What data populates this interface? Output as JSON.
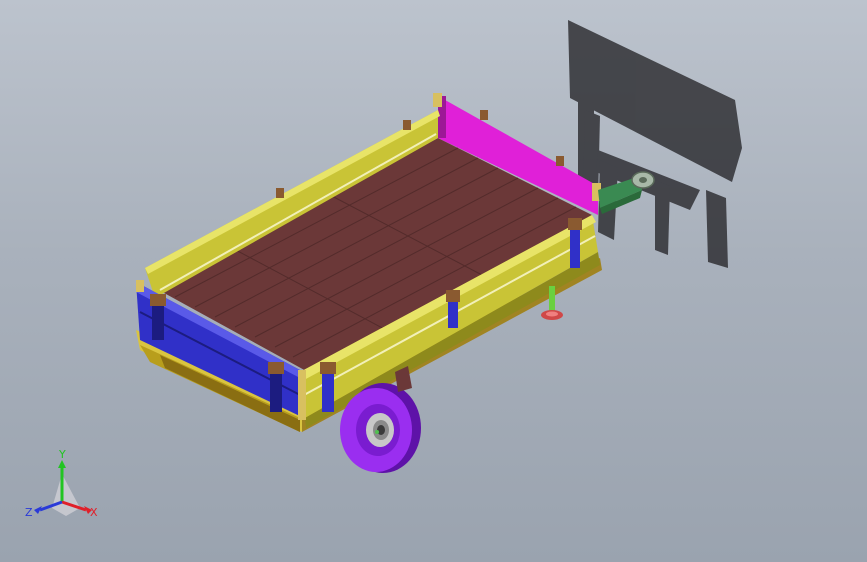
{
  "triad": {
    "x_label": "X",
    "y_label": "Y",
    "z_label": "Z",
    "colors": {
      "x": "#e0202a",
      "y": "#22c422",
      "z": "#2a3ad8"
    }
  },
  "model": {
    "colors": {
      "bed": "#6b3838",
      "bed_dark": "#4e2828",
      "side": "#c9c436",
      "side_dark": "#8e8a1c",
      "front": "#e020d8",
      "front_dark": "#9c1896",
      "rear": "#3030c8",
      "rear_dark": "#1c1c80",
      "chassis": "#d9c440",
      "wheel": "#9a2ef0",
      "wheel_dark": "#5e12a8",
      "hub": "#c8c8c8",
      "jack": "#6ad040",
      "hitch": "#3a8a52",
      "shadow": "#2c2c30"
    }
  }
}
